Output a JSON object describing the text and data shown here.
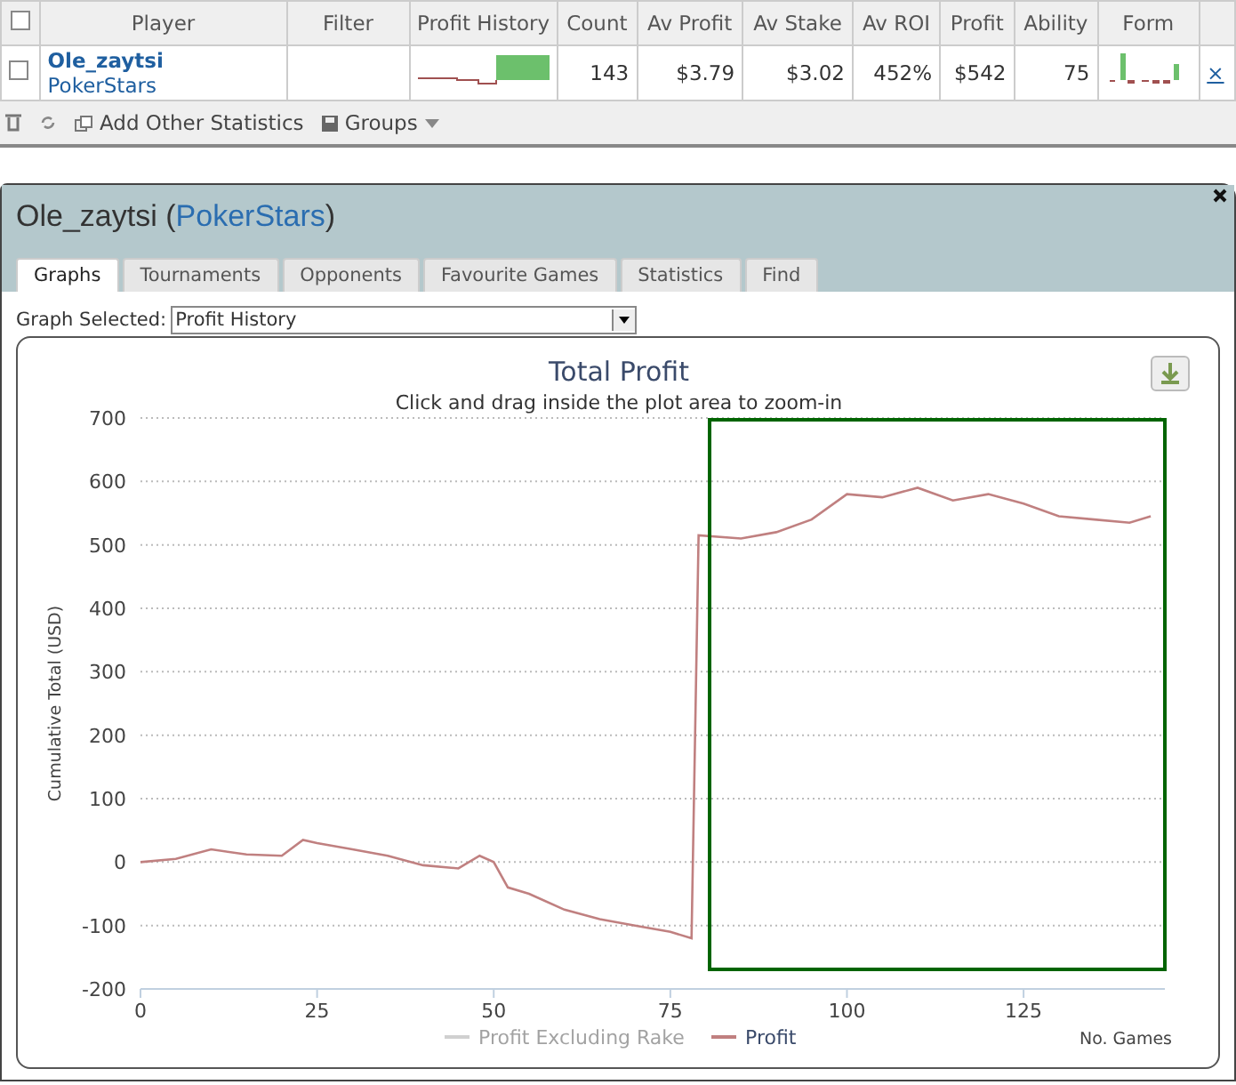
{
  "stats_table": {
    "all_checked": false,
    "columns": [
      "Player",
      "Filter",
      "Profit History",
      "Count",
      "Av Profit",
      "Av Stake",
      "Av ROI",
      "Profit",
      "Ability",
      "Form"
    ],
    "rows": [
      {
        "checked": false,
        "player": "Ole_zaytsi",
        "site": "PokerStars",
        "count": "143",
        "av_profit": "$3.79",
        "av_stake": "$3.02",
        "av_roi": "452%",
        "profit": "$542",
        "ability": "75",
        "remove": "×"
      }
    ]
  },
  "toolbar": {
    "add_label": "Add Other Statistics",
    "groups_label": "Groups"
  },
  "window": {
    "player": "Ole_zaytsi",
    "open_paren": "(",
    "site": "PokerStars",
    "close_paren": ")"
  },
  "tabs": [
    {
      "label": "Graphs",
      "selected": true
    },
    {
      "label": "Tournaments",
      "selected": false
    },
    {
      "label": "Opponents",
      "selected": false
    },
    {
      "label": "Favourite Games",
      "selected": false
    },
    {
      "label": "Statistics",
      "selected": false
    },
    {
      "label": "Find",
      "selected": false
    }
  ],
  "graph_select": {
    "label": "Graph Selected:",
    "value": "Profit History"
  },
  "chart": {
    "subtitle": "Click and drag inside the plot area to zoom-in",
    "legend": [
      {
        "enabled": false
      },
      {
        "enabled": true
      }
    ],
    "chart_data": {
      "type": "line",
      "title": "Total Profit",
      "xlabel": "No. Games",
      "ylabel": "Cumulative Total (USD)",
      "x": [
        0,
        5,
        10,
        15,
        20,
        23,
        25,
        30,
        35,
        40,
        45,
        48,
        50,
        52,
        55,
        60,
        65,
        70,
        75,
        78,
        79,
        85,
        90,
        95,
        100,
        105,
        110,
        115,
        120,
        125,
        130,
        135,
        140,
        143
      ],
      "series": [
        {
          "name": "Profit Excluding Rake",
          "color": "#cccccc",
          "values": [
            null,
            null,
            null,
            null,
            null,
            null,
            null,
            null,
            null,
            null,
            null,
            null,
            null,
            null,
            null,
            null,
            null,
            null,
            null,
            null,
            null,
            null,
            null,
            null,
            null,
            null,
            null,
            null,
            null,
            null,
            null,
            null,
            null,
            null
          ]
        },
        {
          "name": "Profit",
          "color": "#c08080",
          "values": [
            0,
            5,
            20,
            12,
            10,
            35,
            30,
            20,
            10,
            -5,
            -10,
            10,
            0,
            -40,
            -50,
            -75,
            -90,
            -100,
            -110,
            -120,
            515,
            510,
            520,
            540,
            580,
            575,
            590,
            570,
            580,
            565,
            545,
            540,
            535,
            545
          ]
        }
      ],
      "xlim": [
        0,
        145
      ],
      "ylim": [
        -200,
        700
      ],
      "xticks": [
        0,
        25,
        50,
        75,
        100,
        125
      ],
      "yticks": [
        -200,
        -100,
        0,
        100,
        200,
        300,
        400,
        500,
        600,
        700
      ],
      "grid": true
    }
  }
}
